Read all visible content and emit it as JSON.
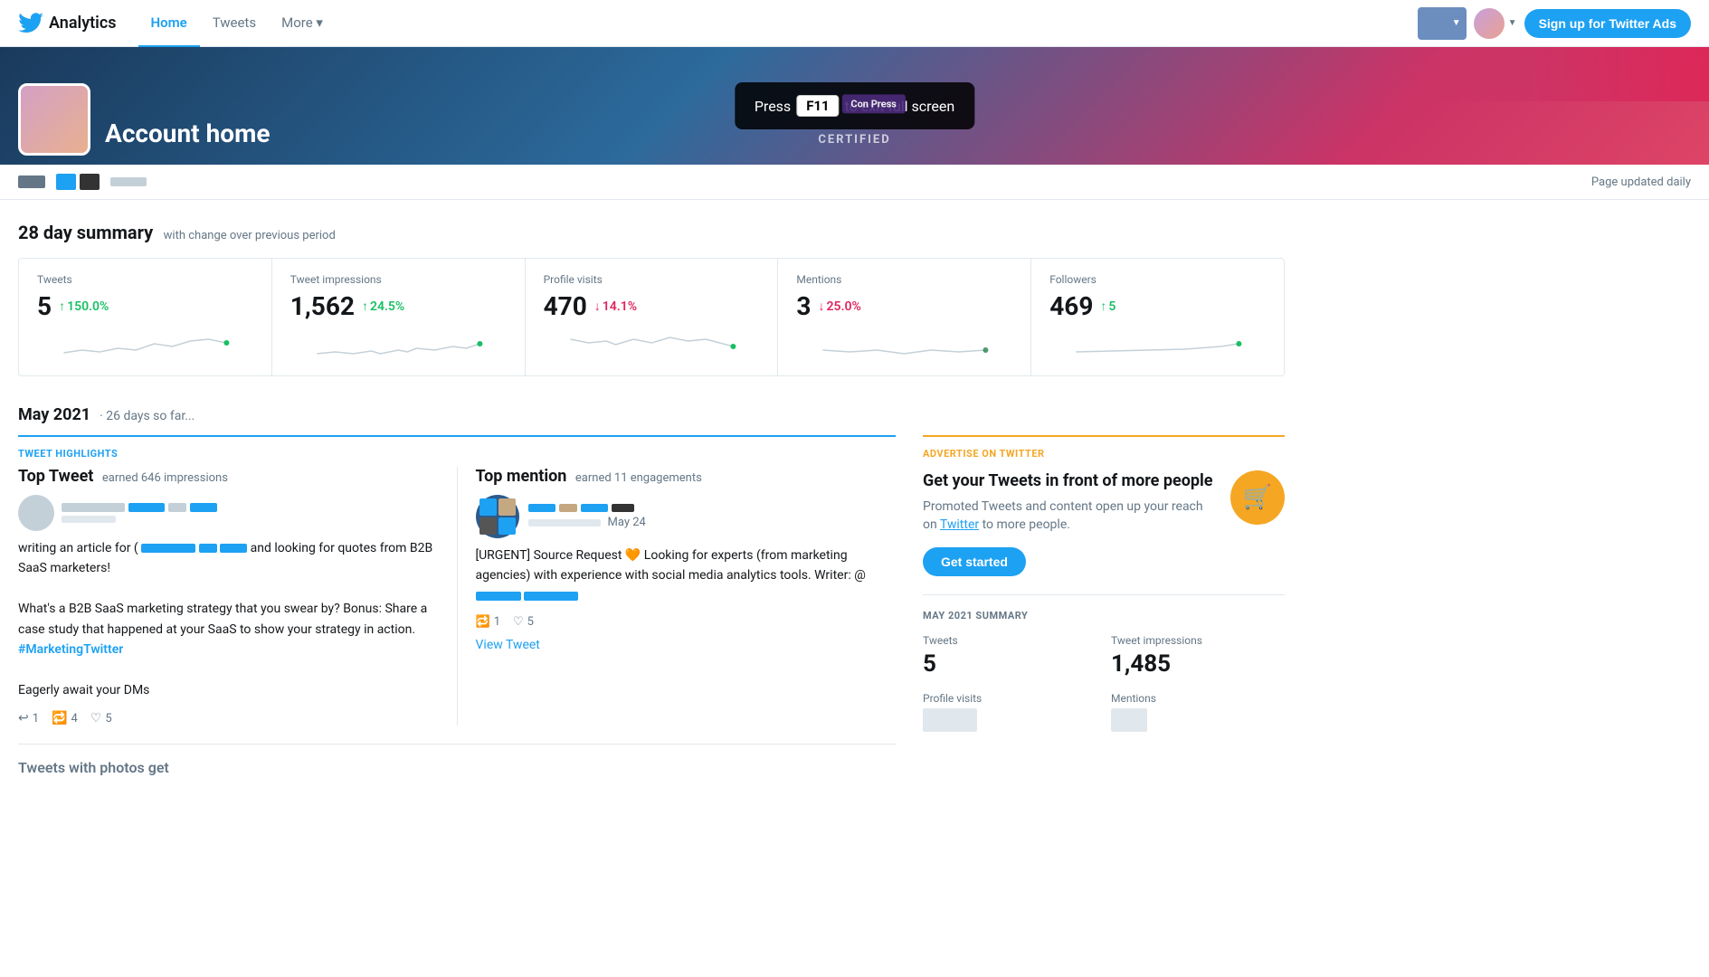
{
  "nav": {
    "brand": "Analytics",
    "links": [
      {
        "label": "Home",
        "active": true
      },
      {
        "label": "Tweets",
        "active": false
      },
      {
        "label": "More ▾",
        "active": false
      }
    ],
    "signup_label": "Sign up for Twitter Ads"
  },
  "hero": {
    "title": "Account home",
    "fullscreen_msg_before": "Press",
    "fullscreen_key": "F11",
    "fullscreen_msg_after": "to exit full screen"
  },
  "subheader": {
    "page_updated": "Page updated daily"
  },
  "summary": {
    "title": "28 day summary",
    "subtitle": "with change over previous period",
    "cards": [
      {
        "label": "Tweets",
        "value": "5",
        "change": "150.0%",
        "direction": "up"
      },
      {
        "label": "Tweet impressions",
        "value": "1,562",
        "change": "24.5%",
        "direction": "up"
      },
      {
        "label": "Profile visits",
        "value": "470",
        "change": "14.1%",
        "direction": "down"
      },
      {
        "label": "Mentions",
        "value": "3",
        "change": "25.0%",
        "direction": "down"
      },
      {
        "label": "Followers",
        "value": "469",
        "change": "5",
        "direction": "up"
      }
    ]
  },
  "period": {
    "title": "May 2021",
    "subtitle": "· 26 days so far..."
  },
  "tweet_highlights": {
    "section_label": "TWEET HIGHLIGHTS",
    "top_tweet": {
      "type": "Top Tweet",
      "earned": "earned 646 impressions",
      "text_parts": [
        "writing an article for (",
        " and looking for quotes from B2B SaaS marketers!",
        "\n\nWhat's a B2B SaaS marketing strategy that you swear by? Bonus: Share a case study that happened at your SaaS to show your strategy in action. ",
        "#MarketingTwitter",
        "\n\nEagerly await your DMs"
      ],
      "stats": {
        "replies": "1",
        "retweets": "4",
        "likes": "5"
      }
    },
    "top_mention": {
      "type": "Top mention",
      "earned": "earned 11 engagements",
      "date": "May 24",
      "text": "[URGENT] Source Request 🧡 Looking for experts (from marketing agencies) with experience with social media analytics tools. Writer: @",
      "stats": {
        "retweets": "1",
        "likes": "5"
      },
      "view_tweet": "View Tweet"
    }
  },
  "advertise": {
    "section_label": "ADVERTISE ON TWITTER",
    "title": "Get your Tweets in front of more people",
    "description": "Promoted Tweets and content open up your reach on Twitter to more people.",
    "cta": "Get started"
  },
  "may_summary": {
    "label": "MAY 2021 SUMMARY",
    "stats": [
      {
        "label": "Tweets",
        "value": "5"
      },
      {
        "label": "Tweet impressions",
        "value": "1,485"
      },
      {
        "label": "Profile visits",
        "value": ""
      },
      {
        "label": "Mentions",
        "value": ""
      }
    ]
  }
}
